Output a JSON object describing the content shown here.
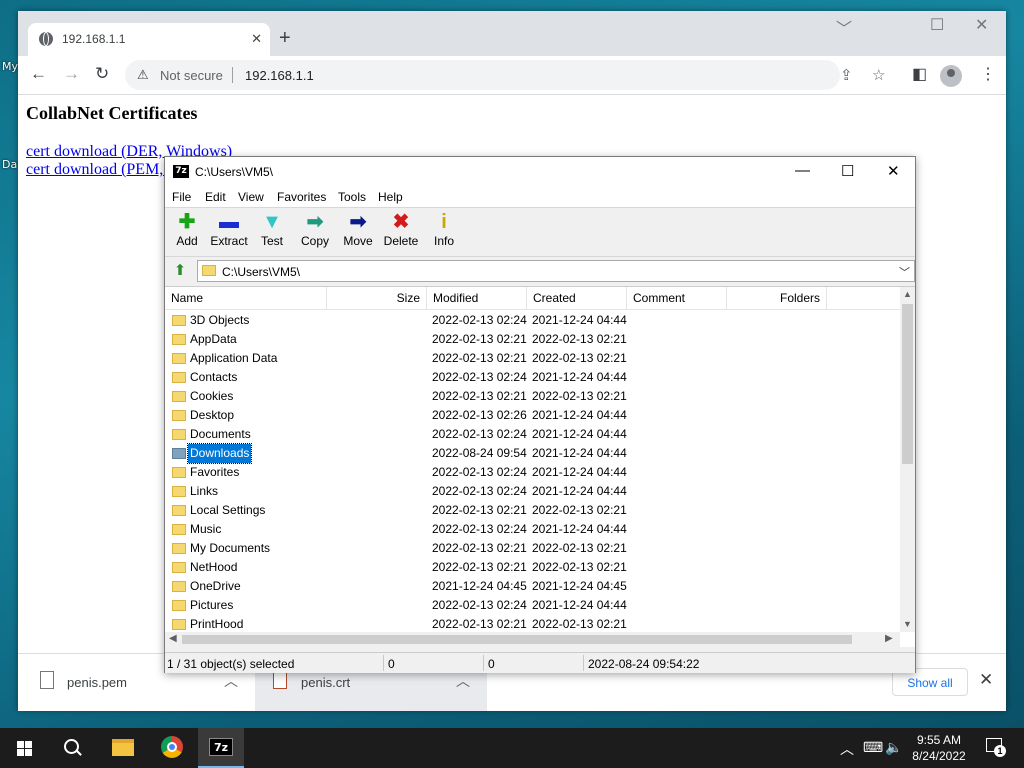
{
  "desktop": {
    "label1": "My",
    "label2": "Da"
  },
  "browser": {
    "tab_title": "192.168.1.1",
    "tab_close": "✕",
    "new_tab": "+",
    "win_min": "﹀",
    "win_max": "☐",
    "win_close": "✕",
    "back": "←",
    "forward": "→",
    "reload": "↻",
    "security_label": "Not secure",
    "url": "192.168.1.1",
    "icons": [
      "back-icon",
      "forward-icon",
      "reload-icon",
      "warning-icon",
      "share-icon",
      "bookmark-star-icon",
      "side-panel-icon",
      "profile-icon",
      "menu-icon"
    ]
  },
  "page": {
    "heading": "CollabNet Certificates",
    "links": [
      "cert download (DER, Windows)",
      "cert download (PEM, Unix)"
    ]
  },
  "downloads": {
    "items": [
      {
        "name": "penis.pem"
      },
      {
        "name": "penis.crt"
      }
    ],
    "show_all": "Show all",
    "close": "✕"
  },
  "sevenzip": {
    "title": "C:\\Users\\VM5\\",
    "logo": "7z",
    "menu": [
      "File",
      "Edit",
      "View",
      "Favorites",
      "Tools",
      "Help"
    ],
    "tools": [
      {
        "label": "Add",
        "glyph": "✚",
        "color": "#19a319"
      },
      {
        "label": "Extract",
        "glyph": "▬",
        "color": "#1a2fd0"
      },
      {
        "label": "Test",
        "glyph": "▼",
        "color": "#2fc6c6"
      },
      {
        "label": "Copy",
        "glyph": "➡",
        "color": "#1d9a7f"
      },
      {
        "label": "Move",
        "glyph": "➡",
        "color": "#0a1a8c"
      },
      {
        "label": "Delete",
        "glyph": "✖",
        "color": "#d41a1a"
      },
      {
        "label": "Info",
        "glyph": "i",
        "color": "#c9a800"
      }
    ],
    "address": "C:\\Users\\VM5\\",
    "columns": [
      "Name",
      "Size",
      "Modified",
      "Created",
      "Comment",
      "Folders"
    ],
    "rows": [
      {
        "name": "3D Objects",
        "modified": "2022-02-13 02:24",
        "created": "2021-12-24 04:44"
      },
      {
        "name": "AppData",
        "modified": "2022-02-13 02:21",
        "created": "2022-02-13 02:21"
      },
      {
        "name": "Application Data",
        "modified": "2022-02-13 02:21",
        "created": "2022-02-13 02:21"
      },
      {
        "name": "Contacts",
        "modified": "2022-02-13 02:24",
        "created": "2021-12-24 04:44"
      },
      {
        "name": "Cookies",
        "modified": "2022-02-13 02:21",
        "created": "2022-02-13 02:21"
      },
      {
        "name": "Desktop",
        "modified": "2022-02-13 02:26",
        "created": "2021-12-24 04:44"
      },
      {
        "name": "Documents",
        "modified": "2022-02-13 02:24",
        "created": "2021-12-24 04:44"
      },
      {
        "name": "Downloads",
        "modified": "2022-08-24 09:54",
        "created": "2021-12-24 04:44",
        "selected": true
      },
      {
        "name": "Favorites",
        "modified": "2022-02-13 02:24",
        "created": "2021-12-24 04:44"
      },
      {
        "name": "Links",
        "modified": "2022-02-13 02:24",
        "created": "2021-12-24 04:44"
      },
      {
        "name": "Local Settings",
        "modified": "2022-02-13 02:21",
        "created": "2022-02-13 02:21"
      },
      {
        "name": "Music",
        "modified": "2022-02-13 02:24",
        "created": "2021-12-24 04:44"
      },
      {
        "name": "My Documents",
        "modified": "2022-02-13 02:21",
        "created": "2022-02-13 02:21"
      },
      {
        "name": "NetHood",
        "modified": "2022-02-13 02:21",
        "created": "2022-02-13 02:21"
      },
      {
        "name": "OneDrive",
        "modified": "2021-12-24 04:45",
        "created": "2021-12-24 04:45"
      },
      {
        "name": "Pictures",
        "modified": "2022-02-13 02:24",
        "created": "2021-12-24 04:44"
      },
      {
        "name": "PrintHood",
        "modified": "2022-02-13 02:21",
        "created": "2022-02-13 02:21"
      }
    ],
    "status": {
      "selection": "1 / 31 object(s) selected",
      "size1": "0",
      "size2": "0",
      "date": "2022-08-24 09:54:22"
    }
  },
  "taskbar": {
    "z7_label": "7z",
    "time": "9:55 AM",
    "date": "8/24/2022",
    "notifications": "1",
    "tray_chevron": "︿"
  }
}
